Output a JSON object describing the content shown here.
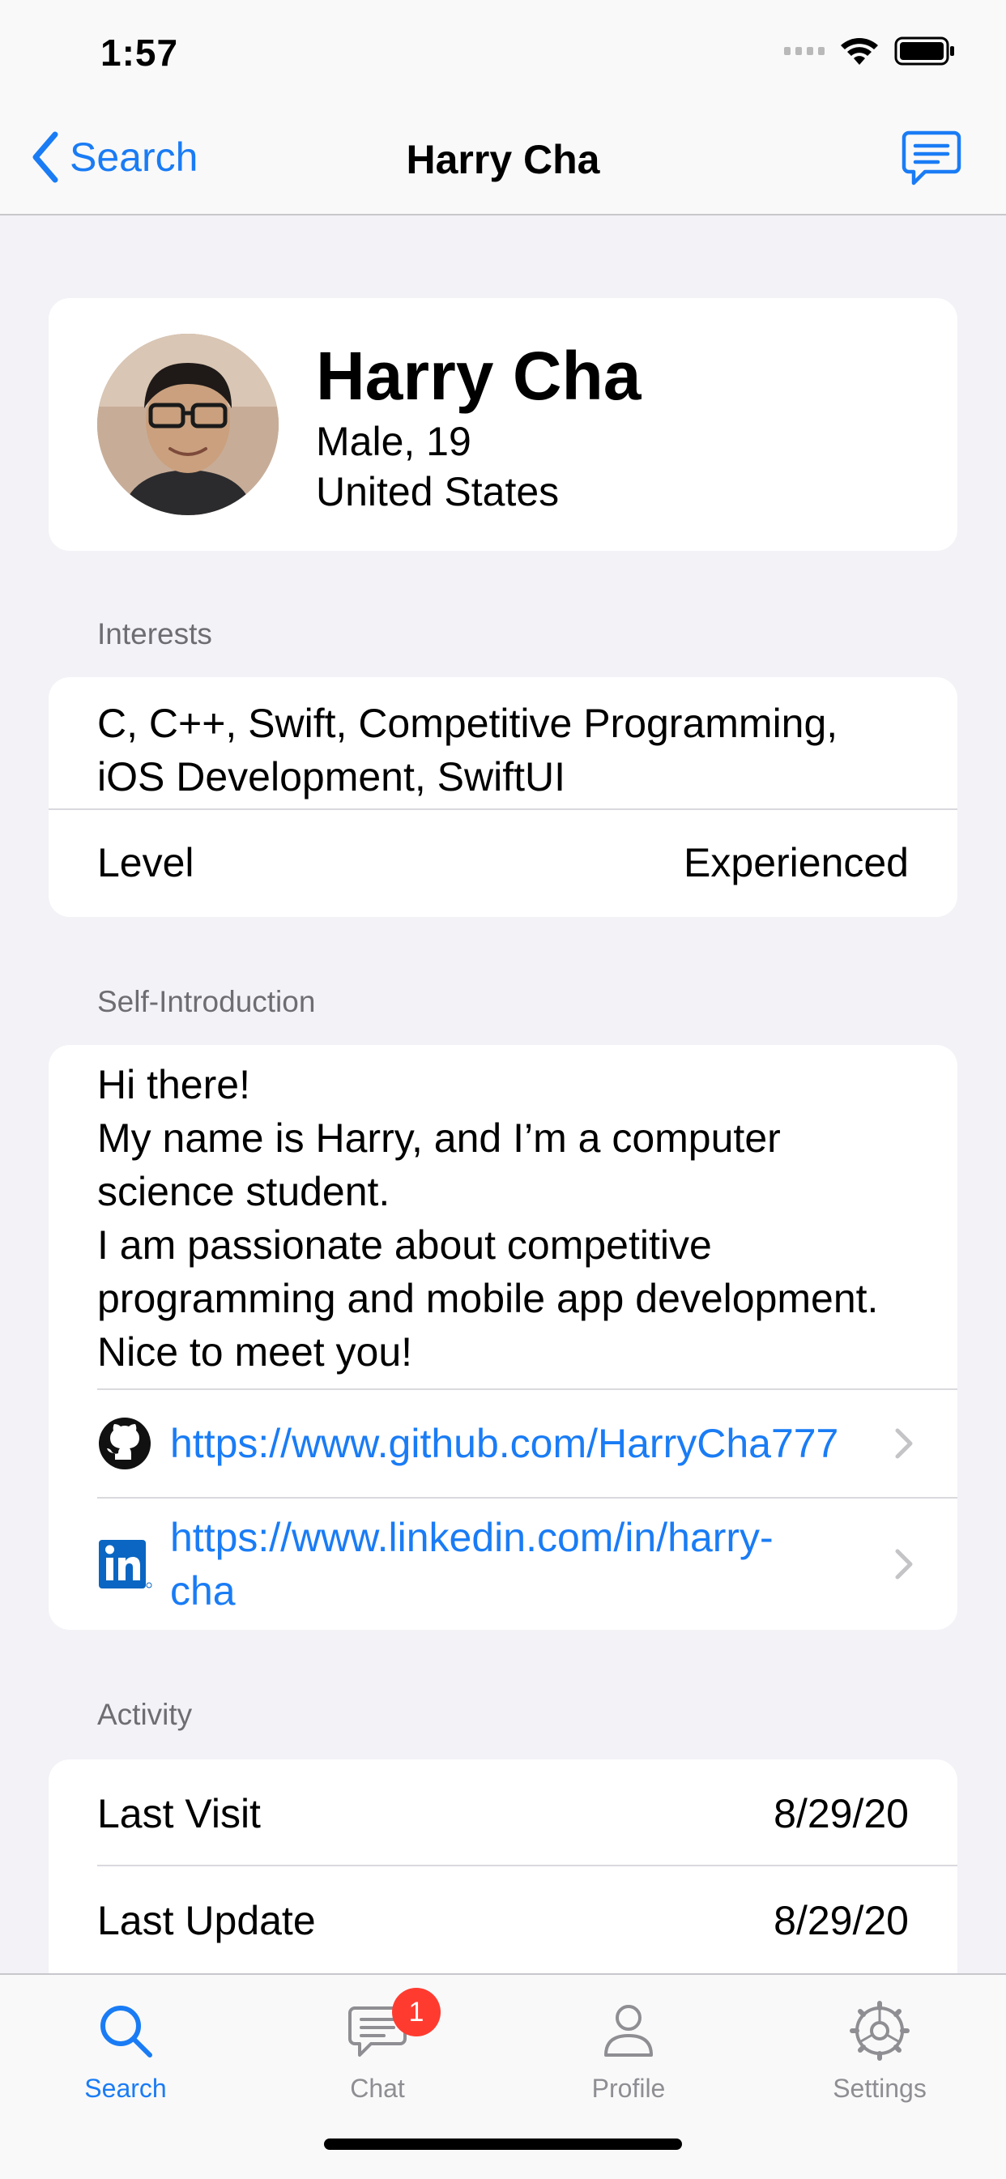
{
  "status_bar": {
    "time": "1:57"
  },
  "nav": {
    "back_label": "Search",
    "title": "Harry Cha"
  },
  "profile": {
    "name": "Harry Cha",
    "gender_age": "Male, 19",
    "country": "United States"
  },
  "interests": {
    "header": "Interests",
    "line1": "C, C++, Swift, Competitive Programming,",
    "line2": "iOS Development, SwiftUI",
    "level_label": "Level",
    "level_value": "Experienced"
  },
  "intro": {
    "header": "Self-Introduction",
    "lines": [
      "Hi there!",
      "My name is Harry, and I’m a computer",
      "science student.",
      "I am passionate about competitive",
      "programming and mobile app development.",
      "Nice to meet you!"
    ],
    "github_url": "https://www.github.com/HarryCha777",
    "linkedin_line1": "https://www.linkedin.com/in/harry-",
    "linkedin_line2": "cha"
  },
  "activity": {
    "header": "Activity",
    "last_visit_label": "Last Visit",
    "last_visit_value": "8/29/20",
    "last_update_label": "Last Update",
    "last_update_value": "8/29/20"
  },
  "tabs": [
    {
      "label": "Search",
      "icon": "search-icon",
      "active": true
    },
    {
      "label": "Chat",
      "icon": "chat-icon",
      "badge": "1"
    },
    {
      "label": "Profile",
      "icon": "person-icon"
    },
    {
      "label": "Settings",
      "icon": "gear-icon"
    }
  ],
  "colors": {
    "accent": "#1a7cf5",
    "background": "#f2f2f7",
    "badge": "#ff3b30"
  }
}
